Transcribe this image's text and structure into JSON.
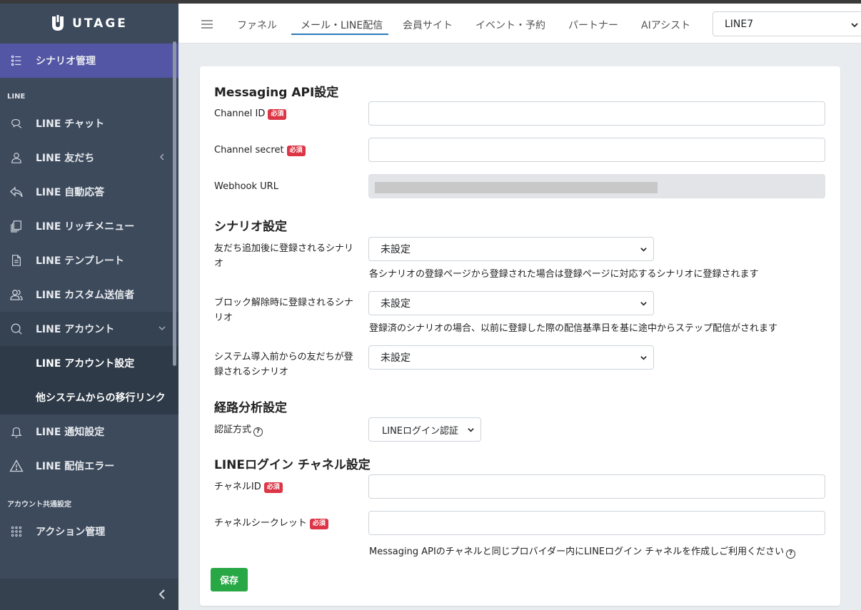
{
  "brand": {
    "name": "UTAGE"
  },
  "sidebar": {
    "top_item": {
      "label": "シナリオ管理",
      "icon": "list-icon"
    },
    "section_line": "LINE",
    "items": [
      {
        "label": "LINE チャット",
        "icon": "chat-icon"
      },
      {
        "label": "LINE 友だち",
        "icon": "user-icon"
      },
      {
        "label": "LINE 自動応答",
        "icon": "reply-icon"
      },
      {
        "label": "LINE リッチメニュー",
        "icon": "menu-stack-icon"
      },
      {
        "label": "LINE テンプレート",
        "icon": "document-icon"
      },
      {
        "label": "LINE カスタム送信者",
        "icon": "users-icon"
      },
      {
        "label": "LINE アカウント",
        "icon": "search-chat-icon"
      }
    ],
    "sub_items": [
      {
        "label": "LINE アカウント設定"
      },
      {
        "label": "他システムからの移行リンク"
      }
    ],
    "items_after": [
      {
        "label": "LINE 通知設定",
        "icon": "bell-icon"
      },
      {
        "label": "LINE 配信エラー",
        "icon": "warning-icon"
      }
    ],
    "section_common": "アカウント共通設定",
    "common_items": [
      {
        "label": "アクション管理",
        "icon": "grid-dots-icon"
      }
    ]
  },
  "topnav": {
    "tabs": [
      "ファネル",
      "メール・LINE配信",
      "会員サイト",
      "イベント・予約",
      "パートナー",
      "AIアシスト"
    ],
    "active_tab": "メール・LINE配信",
    "account_select": "LINE7"
  },
  "form": {
    "messaging_title": "Messaging API設定",
    "channel_id_label": "Channel ID",
    "channel_secret_label": "Channel secret",
    "webhook_label": "Webhook URL",
    "required_badge": "必須",
    "scenario_title": "シナリオ設定",
    "friend_add_label": "友だち追加後に登録されるシナリオ",
    "friend_add_value": "未設定",
    "friend_add_help": "各シナリオの登録ページから登録された場合は登録ページに対応するシナリオに登録されます",
    "unblock_label": "ブロック解除時に登録されるシナリオ",
    "unblock_value": "未設定",
    "unblock_help": "登録済のシナリオの場合、以前に登録した際の配信基準日を基に途中からステップ配信がされます",
    "prior_label": "システム導入前からの友だちが登録されるシナリオ",
    "prior_value": "未設定",
    "route_title": "経路分析設定",
    "auth_label": "認証方式",
    "auth_value": "LINEログイン認証",
    "login_title": "LINEログイン チャネル設定",
    "login_channel_id_label": "チャネルID",
    "login_secret_label": "チャネルシークレット",
    "login_help": "Messaging APIのチャネルと同じプロバイダー内にLINEログイン チャネルを作成しご利用ください",
    "save_label": "保存"
  },
  "colors": {
    "sidebar_bg": "#3d4a5c",
    "active_item": "#5356a4",
    "required_badge": "#dc3545",
    "save_button": "#28a745",
    "tab_underline": "#2a7ab8"
  }
}
